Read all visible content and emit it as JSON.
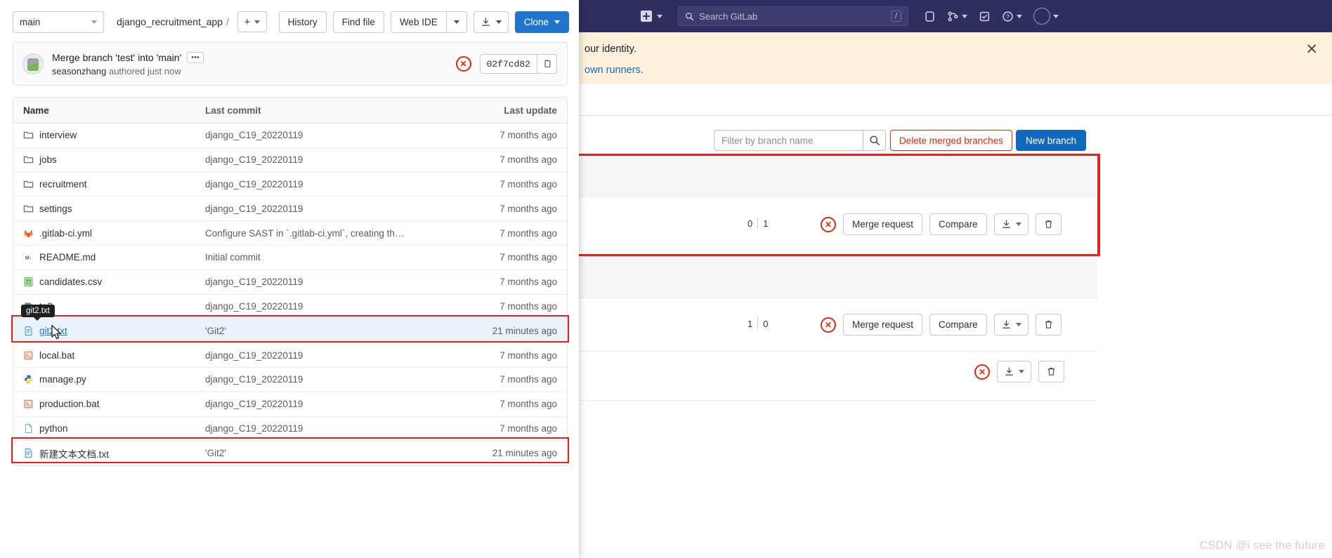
{
  "navbar": {
    "create_label": "create-new-dropdown",
    "search_placeholder": "Search GitLab",
    "slash_key": "/"
  },
  "alert": {
    "line1": "our identity.",
    "line2": "own runners.",
    "close_label": "✕"
  },
  "branches_toolbar": {
    "filter_placeholder": "Filter by branch name",
    "delete_merged_label": "Delete merged branches",
    "new_branch_label": "New branch"
  },
  "branch_rows": [
    {
      "behind": "0",
      "ahead": "1",
      "merge_request_label": "Merge request",
      "compare_label": "Compare",
      "has_mr": true,
      "has_compare": true
    },
    {
      "behind": "1",
      "ahead": "0",
      "merge_request_label": "Merge request",
      "compare_label": "Compare",
      "has_mr": true,
      "has_compare": true
    },
    {
      "behind": "",
      "ahead": "",
      "merge_request_label": "",
      "compare_label": "",
      "has_mr": false,
      "has_compare": false
    }
  ],
  "repo_toolbar": {
    "branch": "main",
    "breadcrumb_project": "django_recruitment_app",
    "breadcrumb_sep": "/",
    "add_label": "+",
    "history_label": "History",
    "find_file_label": "Find file",
    "web_ide_label": "Web IDE",
    "clone_label": "Clone"
  },
  "commit": {
    "title": "Merge branch 'test' into 'main'",
    "more_label": "•••",
    "author": "seasonzhang",
    "meta": "authored just now",
    "sha": "02f7cd82"
  },
  "file_table": {
    "headers": {
      "name": "Name",
      "last_commit": "Last commit",
      "last_update": "Last update"
    },
    "rows": [
      {
        "icon": "folder",
        "name": "interview",
        "commit": "django_C19_20220119",
        "update": "7 months ago",
        "highlight": false
      },
      {
        "icon": "folder",
        "name": "jobs",
        "commit": "django_C19_20220119",
        "update": "7 months ago",
        "highlight": false
      },
      {
        "icon": "folder",
        "name": "recruitment",
        "commit": "django_C19_20220119",
        "update": "7 months ago",
        "highlight": false
      },
      {
        "icon": "folder",
        "name": "settings",
        "commit": "django_C19_20220119",
        "update": "7 months ago",
        "highlight": false
      },
      {
        "icon": "gitlab",
        "name": ".gitlab-ci.yml",
        "commit": "Configure SAST in `.gitlab-ci.yml`, creating th…",
        "update": "7 months ago",
        "highlight": false
      },
      {
        "icon": "md",
        "name": "README.md",
        "commit": "Initial commit",
        "update": "7 months ago",
        "highlight": false
      },
      {
        "icon": "csv",
        "name": "candidates.csv",
        "commit": "django_C19_20220119",
        "update": "7 months ago",
        "highlight": false
      },
      {
        "icon": "db",
        "name": "te3",
        "commit": "django_C19_20220119",
        "update": "7 months ago",
        "highlight": false
      },
      {
        "icon": "txt",
        "name": "git2.txt",
        "commit": "'Git2'",
        "update": "21 minutes ago",
        "highlight": true
      },
      {
        "icon": "bat",
        "name": "local.bat",
        "commit": "django_C19_20220119",
        "update": "7 months ago",
        "highlight": false
      },
      {
        "icon": "py",
        "name": "manage.py",
        "commit": "django_C19_20220119",
        "update": "7 months ago",
        "highlight": false
      },
      {
        "icon": "bat",
        "name": "production.bat",
        "commit": "django_C19_20220119",
        "update": "7 months ago",
        "highlight": false
      },
      {
        "icon": "file",
        "name": "python",
        "commit": "django_C19_20220119",
        "update": "7 months ago",
        "highlight": false
      },
      {
        "icon": "txt",
        "name": "新建文本文档.txt",
        "commit": "'Git2'",
        "update": "21 minutes ago",
        "highlight": false
      }
    ]
  },
  "tooltip": {
    "text": "git2.txt"
  },
  "watermark": {
    "text": "CSDN @i see the future"
  },
  "colors": {
    "navbar": "#2e2e5f",
    "accent_blue": "#1f75cb",
    "link_blue": "#1068bf",
    "danger_red": "#dd2b0e",
    "annotation_red": "#e8201c",
    "alert_bg": "#fdf1dd",
    "row_highlight": "#e9f3fc"
  }
}
